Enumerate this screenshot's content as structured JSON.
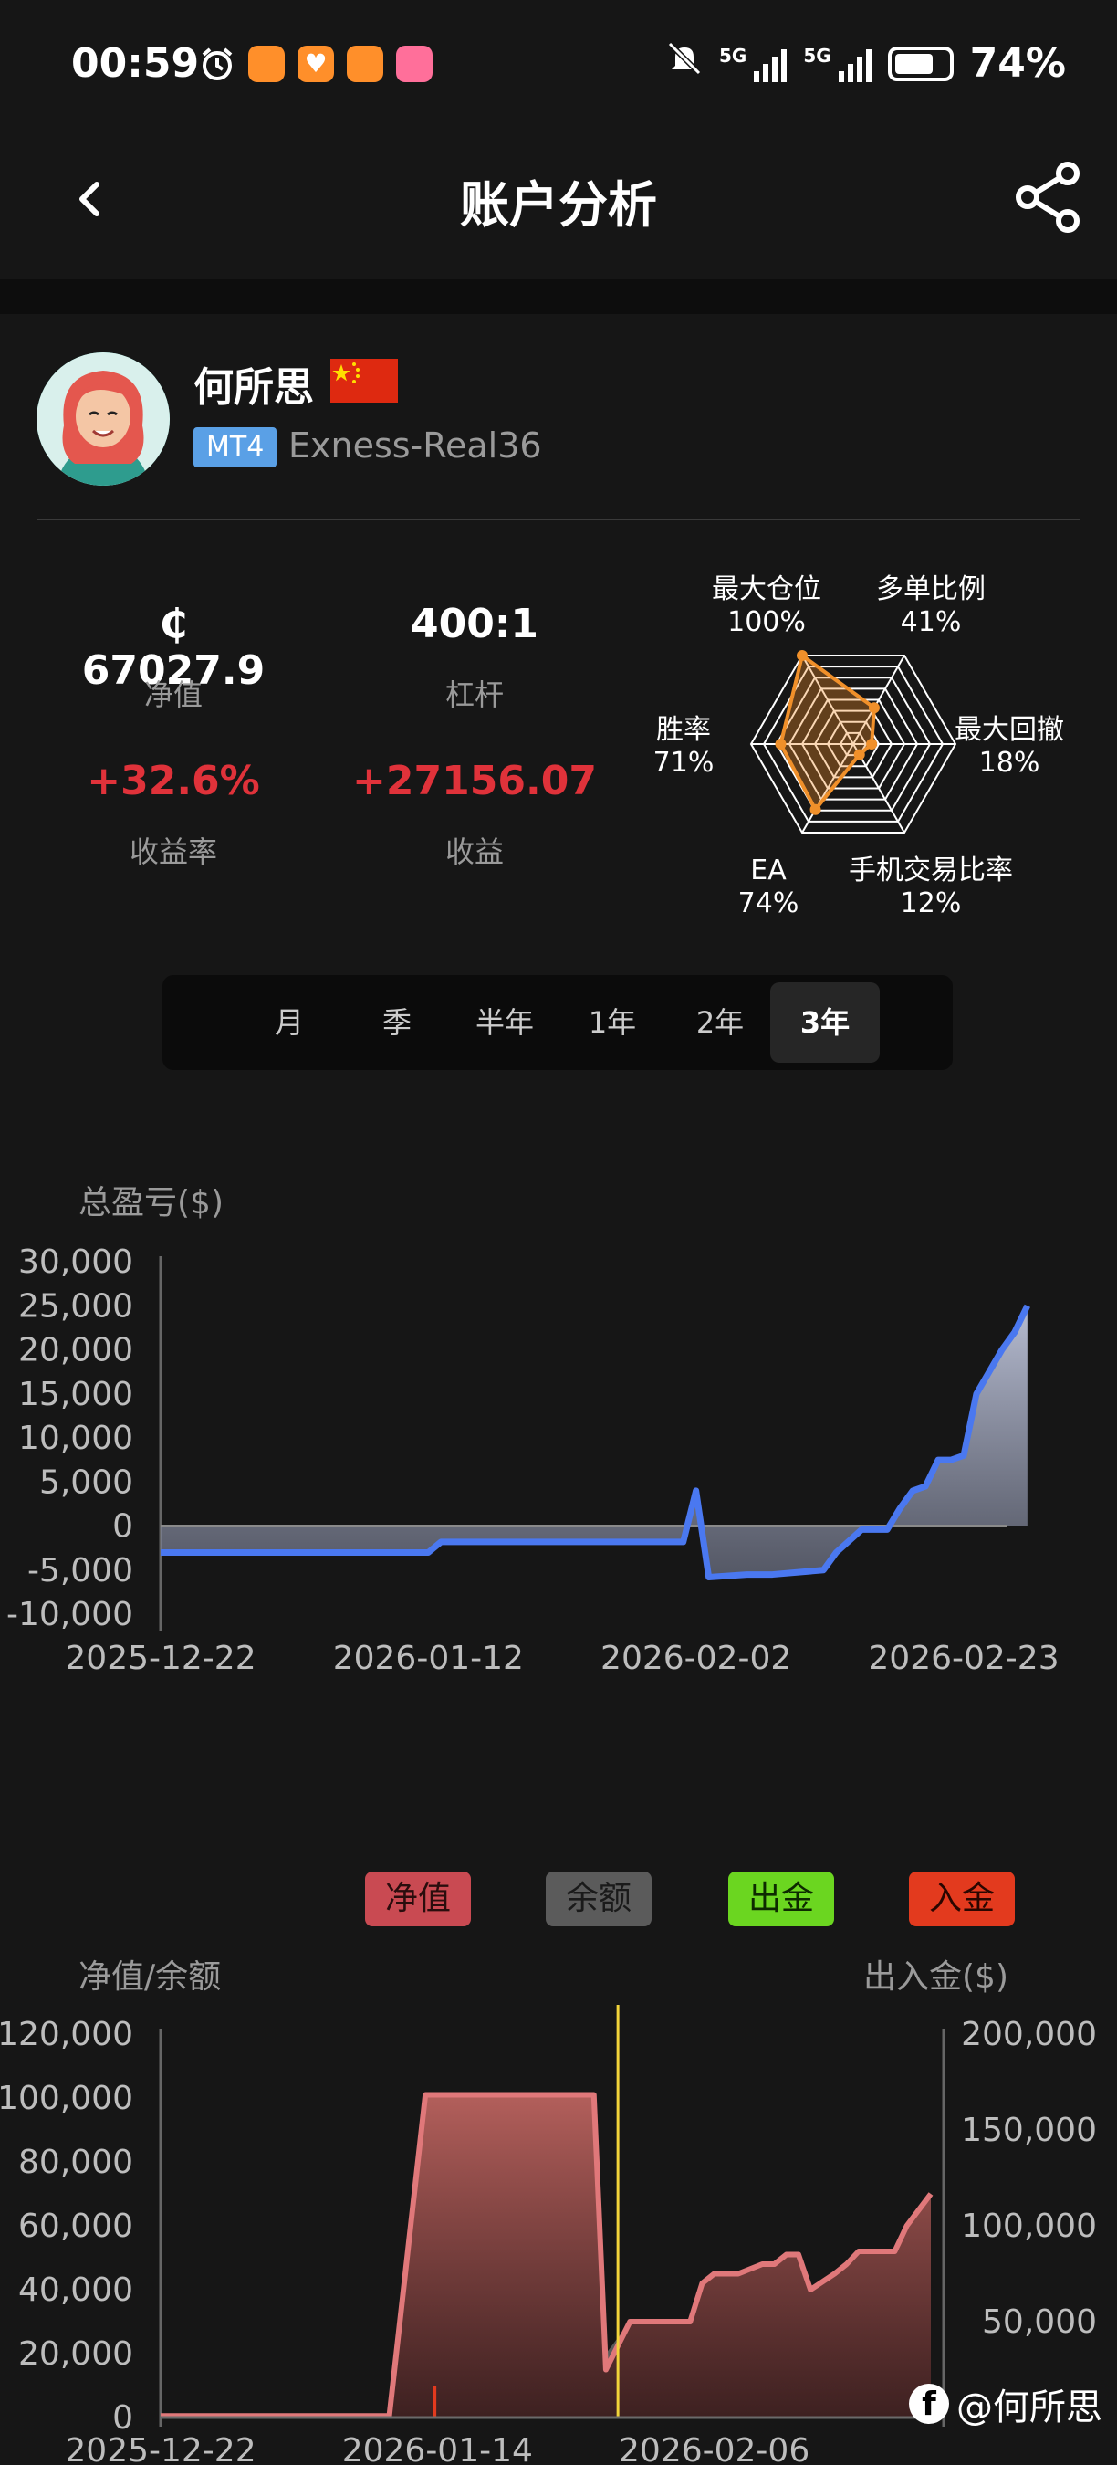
{
  "status_bar": {
    "time": "00:59",
    "app_icons": [
      "alarm-icon",
      "app-icon-orange",
      "app-icon-heart",
      "app-icon-orange",
      "app-icon-bilibili"
    ],
    "sim1": "5G",
    "sim2": "5G",
    "battery": "74%",
    "battery_level": 0.74
  },
  "nav": {
    "title": "账户分析",
    "back_icon": "chevron-left-icon",
    "share_icon": "share-icon"
  },
  "profile": {
    "name": "何所思",
    "flag": "china-flag-icon",
    "platform_badge": "MT4",
    "server": "Exness-Real36"
  },
  "stats": {
    "equity_value": "₵ 67027.9",
    "equity_label": "净值",
    "leverage_value": "400:1",
    "leverage_label": "杠杆",
    "return_value": "+32.6%",
    "return_label": "收益率",
    "profit_value": "+27156.07",
    "profit_label": "收益"
  },
  "radar": {
    "axes": [
      {
        "name": "最大仓位",
        "value_label": "100%",
        "value": 1.0
      },
      {
        "name": "多单比例",
        "value_label": "41%",
        "value": 0.41
      },
      {
        "name": "最大回撤",
        "value_label": "18%",
        "value": 0.18
      },
      {
        "name": "手机交易比率",
        "value_label": "12%",
        "value": 0.12
      },
      {
        "name": "EA",
        "value_label": "74%",
        "value": 0.74
      },
      {
        "name": "胜率",
        "value_label": "71%",
        "value": 0.71
      }
    ]
  },
  "period_tabs": [
    "月",
    "季",
    "半年",
    "1年",
    "2年",
    "3年"
  ],
  "active_period": "3年",
  "chart_data": [
    {
      "type": "area",
      "ylabel": "总盈亏($)",
      "x_ticks": [
        "2025-12-22",
        "2026-01-12",
        "2026-02-02",
        "2026-02-23"
      ],
      "y_ticks": [
        "30,000",
        "25,000",
        "20,000",
        "15,000",
        "10,000",
        "5,000",
        "0",
        "-5,000",
        "-10,000"
      ],
      "ylim": [
        -10000,
        30000
      ],
      "x": [
        "2025-12-22",
        "2026-01-01",
        "2026-01-12",
        "2026-01-13",
        "2026-01-25",
        "2026-02-01",
        "2026-02-02",
        "2026-02-03",
        "2026-02-06",
        "2026-02-08",
        "2026-02-12",
        "2026-02-13",
        "2026-02-15",
        "2026-02-16",
        "2026-02-17",
        "2026-02-18",
        "2026-02-19",
        "2026-02-20",
        "2026-02-21",
        "2026-02-22",
        "2026-02-23",
        "2026-02-24",
        "2026-02-26",
        "2026-02-27",
        "2026-02-28"
      ],
      "series": [
        {
          "values": [
            -3000,
            -3000,
            -3000,
            -1800,
            -1800,
            -1800,
            4000,
            -5800,
            -5500,
            -5500,
            -5000,
            -3000,
            -400,
            -400,
            -400,
            2000,
            4000,
            4500,
            7500,
            7500,
            8000,
            15000,
            20000,
            22000,
            25000
          ]
        }
      ]
    },
    {
      "type": "area",
      "ylabel": "净值/余额",
      "y2label": "出入金($)",
      "x_ticks": [
        "2025-12-22",
        "2026-01-14",
        "2026-02-06"
      ],
      "y_ticks": [
        "120,000",
        "100,000",
        "80,000",
        "60,000",
        "40,000",
        "20,000",
        "0"
      ],
      "y2_ticks": [
        "200,000",
        "150,000",
        "100,000",
        "50,000"
      ],
      "ylim": [
        0,
        120000
      ],
      "legend": [
        "净值",
        "余额",
        "出金",
        "入金"
      ],
      "legend_colors": [
        "#c94a52",
        "#5b5b5b",
        "#6bd620",
        "#e33a1e"
      ],
      "x": [
        "2025-12-22",
        "2026-01-10",
        "2026-01-13",
        "2026-01-14",
        "2026-01-20",
        "2026-01-26",
        "2026-01-27",
        "2026-01-28",
        "2026-01-30",
        "2026-02-02",
        "2026-02-04",
        "2026-02-05",
        "2026-02-06",
        "2026-02-08",
        "2026-02-10",
        "2026-02-11",
        "2026-02-12",
        "2026-02-13",
        "2026-02-14",
        "2026-02-16",
        "2026-02-17",
        "2026-02-18",
        "2026-02-19",
        "2026-02-21",
        "2026-02-22",
        "2026-02-24"
      ],
      "series": [
        {
          "name": "净值",
          "values": [
            500,
            500,
            101000,
            101000,
            101000,
            101000,
            101000,
            15000,
            30000,
            30000,
            30000,
            42000,
            45000,
            45000,
            48000,
            48000,
            51000,
            51000,
            40000,
            45000,
            48000,
            52000,
            52000,
            52000,
            60000,
            70000
          ]
        },
        {
          "name": "余额",
          "values": [
            500,
            500,
            101500,
            101500,
            101500,
            101500,
            101500,
            20000,
            30000,
            30000,
            30000,
            42000,
            45000,
            45000,
            48000,
            48000,
            51000,
            51000,
            40000,
            45000,
            48000,
            52000,
            52000,
            52000,
            60000,
            70000
          ]
        }
      ],
      "withdrawal_marker_date": "2026-01-29",
      "deposit_marker_date": "2026-01-13"
    }
  ],
  "watermark": "@何所思",
  "watermark_icon": "facebook-icon"
}
